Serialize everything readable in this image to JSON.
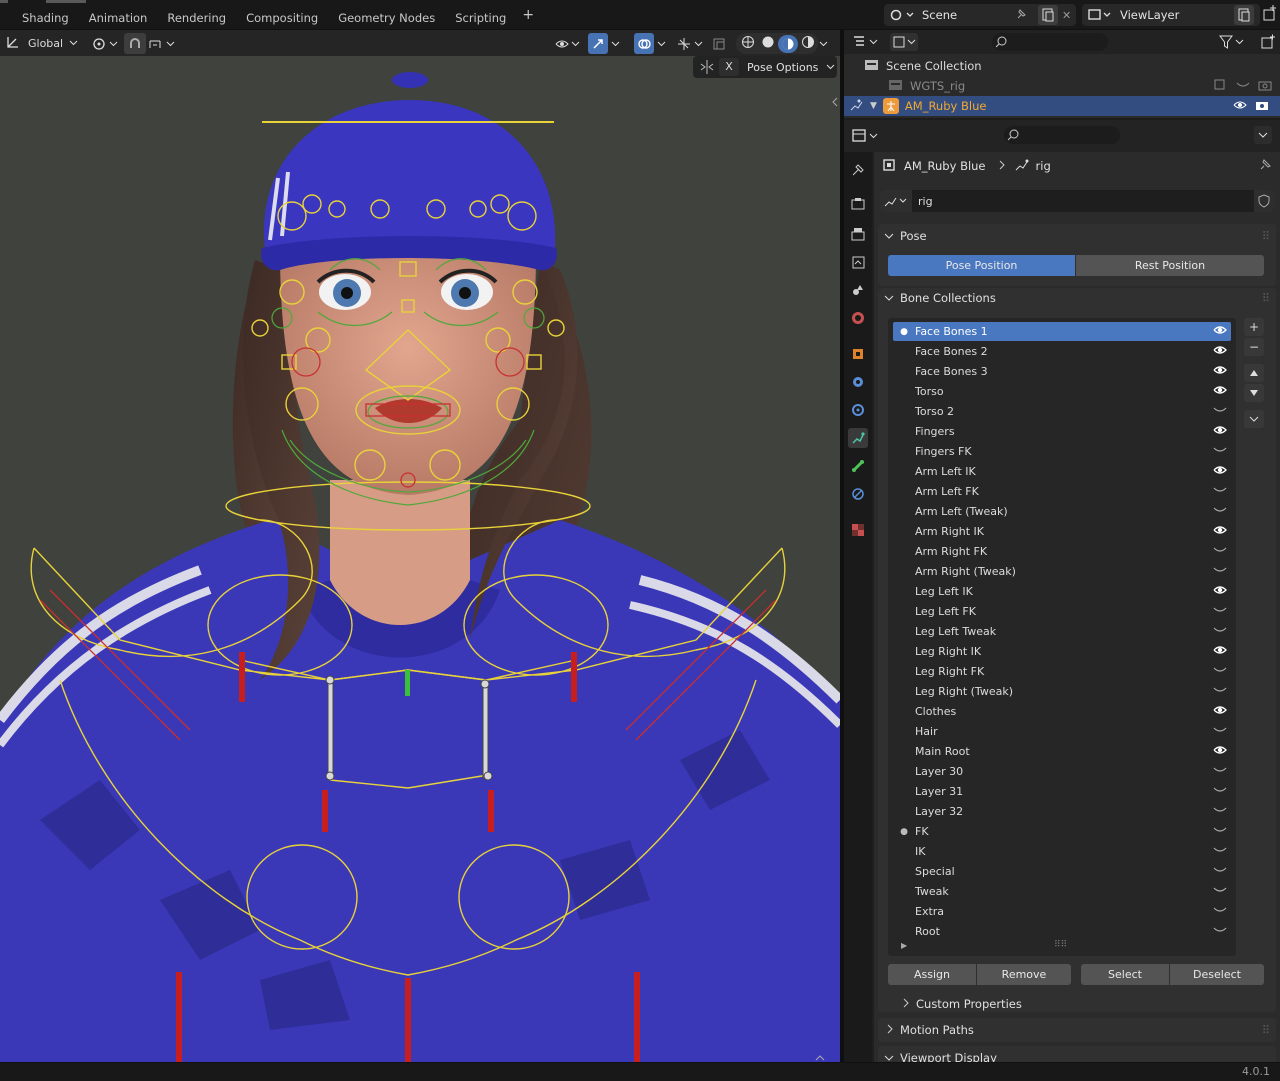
{
  "workspaces": [
    "Shading",
    "Animation",
    "Rendering",
    "Compositing",
    "Geometry Nodes",
    "Scripting"
  ],
  "add_workspace": "+",
  "scene": {
    "name": "Scene"
  },
  "view_layer": {
    "name": "ViewLayer"
  },
  "viewport_header": {
    "orientation": "Global"
  },
  "pose_options": {
    "close": "X",
    "label": "Pose Options"
  },
  "outliner": {
    "scene_collection": "Scene Collection",
    "items": [
      "WGTS_rig",
      "AM_Ruby Blue"
    ]
  },
  "properties": {
    "breadcrumb_object": "AM_Ruby Blue",
    "breadcrumb_data": "rig",
    "datablock_name": "rig",
    "pose_panel": {
      "title": "Pose",
      "pose_position": "Pose Position",
      "rest_position": "Rest Position"
    },
    "bone_collections_panel": {
      "title": "Bone Collections",
      "items": [
        {
          "name": "Face Bones 1",
          "visible": true,
          "active": true
        },
        {
          "name": "Face Bones 2",
          "visible": true
        },
        {
          "name": "Face Bones 3",
          "visible": true
        },
        {
          "name": "Torso",
          "visible": true
        },
        {
          "name": "Torso 2",
          "visible": false
        },
        {
          "name": "Fingers",
          "visible": true
        },
        {
          "name": "Fingers FK",
          "visible": false
        },
        {
          "name": "Arm Left IK",
          "visible": true
        },
        {
          "name": "Arm Left FK",
          "visible": false
        },
        {
          "name": "Arm Left (Tweak)",
          "visible": false
        },
        {
          "name": "Arm Right IK",
          "visible": true
        },
        {
          "name": "Arm Right FK",
          "visible": false
        },
        {
          "name": "Arm Right (Tweak)",
          "visible": false
        },
        {
          "name": "Leg Left IK",
          "visible": true
        },
        {
          "name": "Leg Left FK",
          "visible": false
        },
        {
          "name": "Leg Left Tweak",
          "visible": false
        },
        {
          "name": "Leg Right IK",
          "visible": true
        },
        {
          "name": "Leg Right FK",
          "visible": false
        },
        {
          "name": "Leg Right (Tweak)",
          "visible": false
        },
        {
          "name": "Clothes",
          "visible": true
        },
        {
          "name": "Hair",
          "visible": false
        },
        {
          "name": "Main Root",
          "visible": true
        },
        {
          "name": "Layer 30",
          "visible": false
        },
        {
          "name": "Layer 31",
          "visible": false
        },
        {
          "name": "Layer 32",
          "visible": false
        },
        {
          "name": "FK",
          "visible": false,
          "dot": true
        },
        {
          "name": "IK",
          "visible": false
        },
        {
          "name": "Special",
          "visible": false
        },
        {
          "name": "Tweak",
          "visible": false
        },
        {
          "name": "Extra",
          "visible": false
        },
        {
          "name": "Root",
          "visible": false
        }
      ],
      "assign": "Assign",
      "remove": "Remove",
      "select": "Select",
      "deselect": "Deselect",
      "custom_properties": "Custom Properties"
    },
    "motion_paths": "Motion Paths",
    "viewport_display": "Viewport Display"
  },
  "version": "4.0.1",
  "colors": {
    "accent": "#4a78c0",
    "outliner_selected": "#334d80",
    "armature_name": "#f0a830"
  }
}
